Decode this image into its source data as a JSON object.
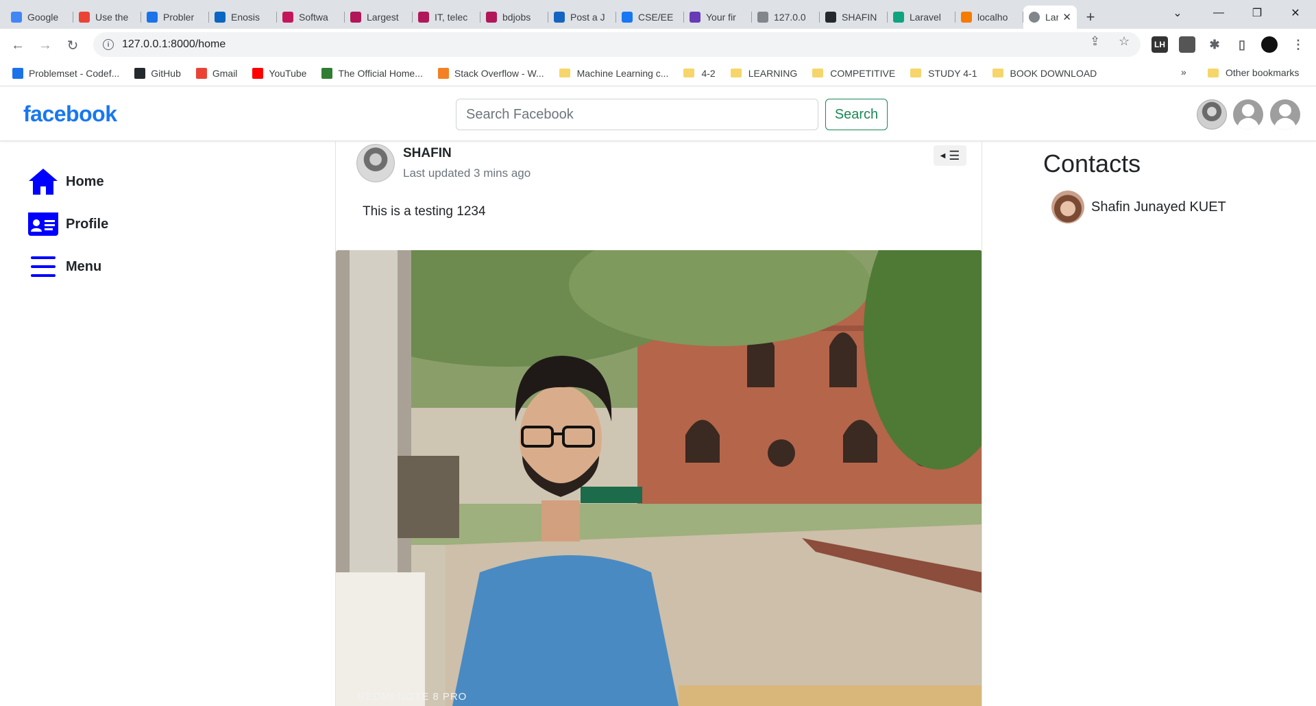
{
  "browser": {
    "tabs": [
      {
        "title": "Google",
        "icon": "google-icon",
        "color": "#4285f4"
      },
      {
        "title": "Use the",
        "icon": "gmail-icon",
        "color": "#ea4335"
      },
      {
        "title": "Probler",
        "icon": "codeforces-icon",
        "color": "#1a73e8"
      },
      {
        "title": "Enosis",
        "icon": "linkedin-icon",
        "color": "#0a66c2"
      },
      {
        "title": "Softwa",
        "icon": "code-icon",
        "color": "#c2185b"
      },
      {
        "title": "Largest",
        "icon": "bdjobs-icon",
        "color": "#b0185a"
      },
      {
        "title": "IT, telec",
        "icon": "bdjobs-icon",
        "color": "#b0185a"
      },
      {
        "title": "bdjobs",
        "icon": "bdjobs-icon",
        "color": "#b0185a"
      },
      {
        "title": "Post a J",
        "icon": "job-icon",
        "color": "#1565c0"
      },
      {
        "title": "CSE/EE",
        "icon": "facebook-icon",
        "color": "#1877f2"
      },
      {
        "title": "Your fir",
        "icon": "form-icon",
        "color": "#673ab7"
      },
      {
        "title": "127.0.0",
        "icon": "globe-icon",
        "color": "#80868b"
      },
      {
        "title": "SHAFIN",
        "icon": "github-icon",
        "color": "#24292e"
      },
      {
        "title": "Laravel",
        "icon": "chatgpt-icon",
        "color": "#10a37f"
      },
      {
        "title": "localho",
        "icon": "xampp-icon",
        "color": "#f57c00"
      }
    ],
    "active_tab": {
      "title": "Lar",
      "icon": "globe-icon",
      "color": "#80868b"
    },
    "url": "127.0.0.1:8000/home",
    "bookmarks": [
      {
        "label": "Problemset - Codef...",
        "icon": "codeforces-icon",
        "color": "#1a73e8",
        "type": "site"
      },
      {
        "label": "GitHub",
        "icon": "github-icon",
        "color": "#24292e",
        "type": "site"
      },
      {
        "label": "Gmail",
        "icon": "gmail-icon",
        "color": "#ea4335",
        "type": "site"
      },
      {
        "label": "YouTube",
        "icon": "youtube-icon",
        "color": "#ff0000",
        "type": "site"
      },
      {
        "label": "The Official Home...",
        "icon": "site-icon",
        "color": "#2e7d32",
        "type": "site"
      },
      {
        "label": "Stack Overflow - W...",
        "icon": "stackoverflow-icon",
        "color": "#f48024",
        "type": "site"
      },
      {
        "label": "Machine Learning c...",
        "icon": "folder-icon",
        "color": "#f6d66b",
        "type": "folder"
      },
      {
        "label": "4-2",
        "icon": "folder-icon",
        "color": "#f6d66b",
        "type": "folder"
      },
      {
        "label": "LEARNING",
        "icon": "folder-icon",
        "color": "#f6d66b",
        "type": "folder"
      },
      {
        "label": "COMPETITIVE",
        "icon": "folder-icon",
        "color": "#f6d66b",
        "type": "folder"
      },
      {
        "label": "STUDY 4-1",
        "icon": "folder-icon",
        "color": "#f6d66b",
        "type": "folder"
      },
      {
        "label": "BOOK DOWNLOAD",
        "icon": "folder-icon",
        "color": "#f6d66b",
        "type": "folder"
      }
    ],
    "bookmarks_overflow": "»",
    "other_bookmarks": "Other bookmarks"
  },
  "header": {
    "logo": "facebook",
    "search_placeholder": "Search Facebook",
    "search_button": "Search",
    "brand_color": "#1877f2",
    "search_button_color": "#198754"
  },
  "sidebar": {
    "items": [
      {
        "label": "Home",
        "icon": "home-icon"
      },
      {
        "label": "Profile",
        "icon": "id-card-icon"
      },
      {
        "label": "Menu",
        "icon": "bars-icon"
      }
    ],
    "icon_color": "#0000ff"
  },
  "post": {
    "author": "SHAFIN",
    "timestamp": "Last updated 3 mins ago",
    "text": "This is a testing 1234",
    "photo_caption": "REDMI NOTE 8 PRO"
  },
  "contacts": {
    "title": "Contacts",
    "list": [
      {
        "name": "Shafin Junayed KUET"
      }
    ]
  }
}
